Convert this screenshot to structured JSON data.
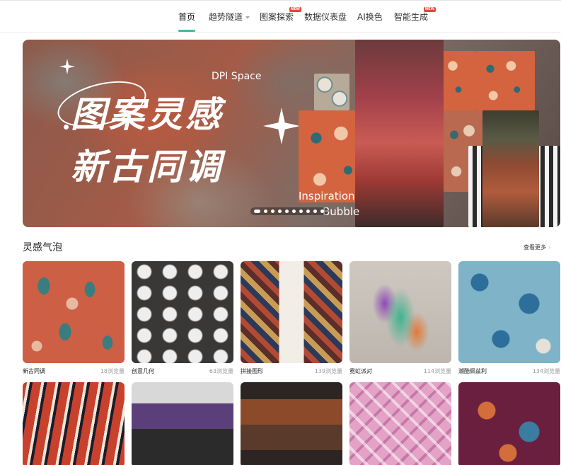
{
  "nav": {
    "items": [
      {
        "label": "首页",
        "active": true,
        "has_caret": false,
        "badge": ""
      },
      {
        "label": "趋势隧道",
        "active": false,
        "has_caret": true,
        "badge": ""
      },
      {
        "label": "图案探索",
        "active": false,
        "has_caret": false,
        "badge": "NEW"
      },
      {
        "label": "数据仪表盘",
        "active": false,
        "has_caret": false,
        "badge": ""
      },
      {
        "label": "AI换色",
        "active": false,
        "has_caret": false,
        "badge": ""
      },
      {
        "label": "智能生成",
        "active": false,
        "has_caret": false,
        "badge": "NEW"
      }
    ],
    "accent_color": "#46b89a",
    "badge_color": "#e8463c"
  },
  "banner": {
    "title_line1": "图案灵感",
    "title_line2": "新古同调",
    "brand": "DPI Space",
    "tagline_line1": "Inspiration",
    "tagline_line2": "Bubble",
    "slide_count": 10,
    "active_slide": 0
  },
  "section": {
    "title": "灵感气泡",
    "more_label": "查看更多"
  },
  "cards_row1": [
    {
      "name": "新古同调",
      "count": "18浏览量",
      "thumb": "paisley"
    },
    {
      "name": "创意几何",
      "count": "63浏览量",
      "thumb": "geo"
    },
    {
      "name": "拼接图形",
      "count": "139浏览量",
      "thumb": "patch"
    },
    {
      "name": "霓虹派对",
      "count": "114浏览量",
      "thumb": "neon"
    },
    {
      "name": "潮酷佩兹利",
      "count": "134浏览量",
      "thumb": "blue"
    }
  ],
  "cards_row2": [
    {
      "thumb": "red"
    },
    {
      "thumb": "purple"
    },
    {
      "thumb": "brown"
    },
    {
      "thumb": "plaid"
    },
    {
      "thumb": "marble"
    }
  ]
}
